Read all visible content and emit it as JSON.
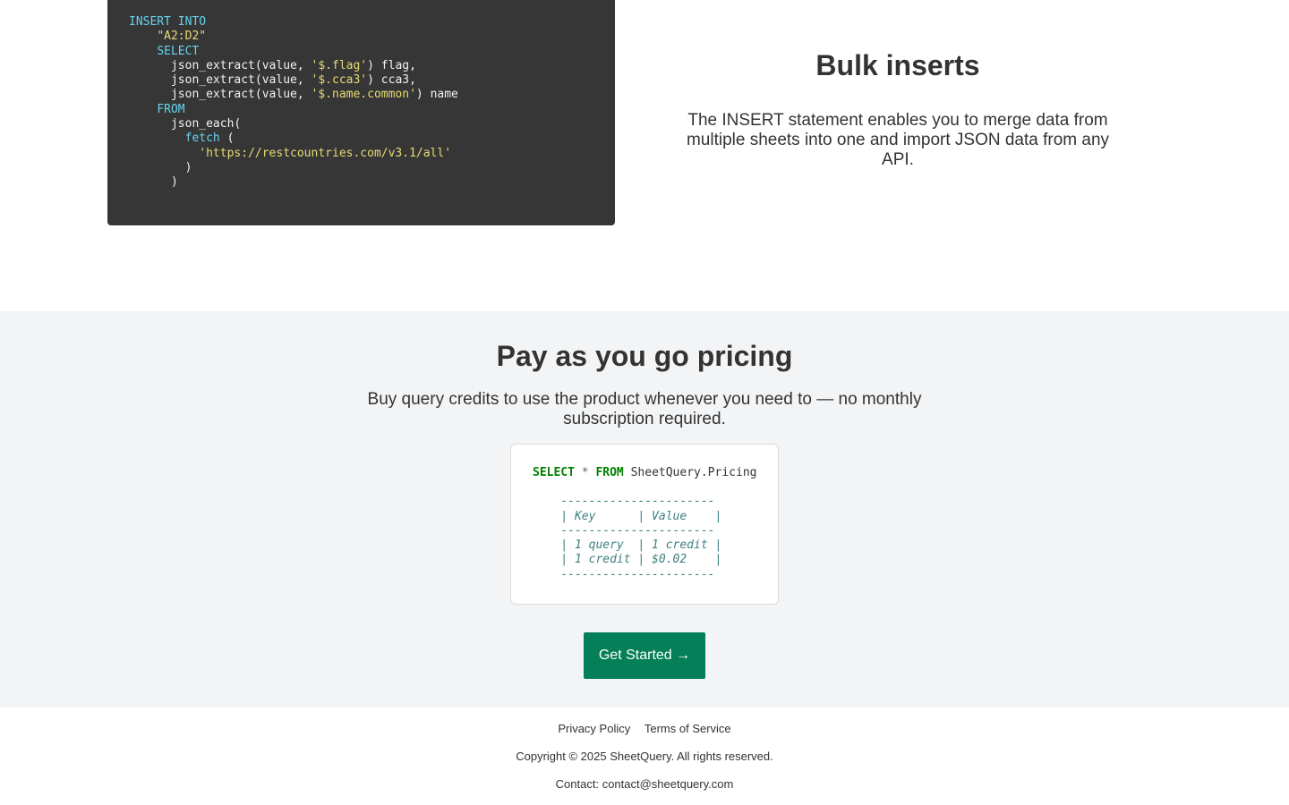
{
  "feature": {
    "title": "Bulk inserts",
    "description": "The INSERT statement enables you to merge data from multiple sheets into one and import JSON data from any API.",
    "code": {
      "insert_into": "INSERT INTO",
      "target_range": "\"A2:D2\"",
      "select": "SELECT",
      "line_flag_pre": "json_extract(value, ",
      "line_flag_str": "'$.flag'",
      "line_flag_post": ") flag,",
      "line_cca3_pre": "json_extract(value, ",
      "line_cca3_str": "'$.cca3'",
      "line_cca3_post": ") cca3,",
      "line_name_pre": "json_extract(value, ",
      "line_name_str": "'$.name.common'",
      "line_name_post": ") name",
      "from": "FROM",
      "json_each": "json_each(",
      "fetch": "fetch",
      "fetch_paren": " (",
      "url": "'https://restcountries.com/v3.1/all'",
      "close_inner": ")",
      "close_outer": ")"
    }
  },
  "pricing": {
    "title": "Pay as you go pricing",
    "description": "Buy query credits to use the product whenever you need to — no monthly subscription required.",
    "query": {
      "select": "SELECT",
      "star": "*",
      "from": "FROM",
      "table": "SheetQuery.Pricing"
    },
    "result_table": "    ----------------------\n    | Key      | Value    |\n    ----------------------\n    | 1 query  | 1 credit |\n    | 1 credit | $0.02    |\n    ----------------------",
    "cta_label": "Get Started →"
  },
  "footer": {
    "links": {
      "privacy": "Privacy Policy",
      "terms": "Terms of Service"
    },
    "copyright": "Copyright © 2025 SheetQuery. All rights reserved.",
    "contact_label": "Contact: ",
    "contact_email": "contact@sheetquery.com"
  },
  "colors": {
    "code_bg": "#363636",
    "keyword": "#66d3ee",
    "string": "#e6db74",
    "pricing_bg": "#f3f4f6",
    "sql_keyword": "#008000",
    "comment": "#408080",
    "cta_bg": "#047f57"
  }
}
